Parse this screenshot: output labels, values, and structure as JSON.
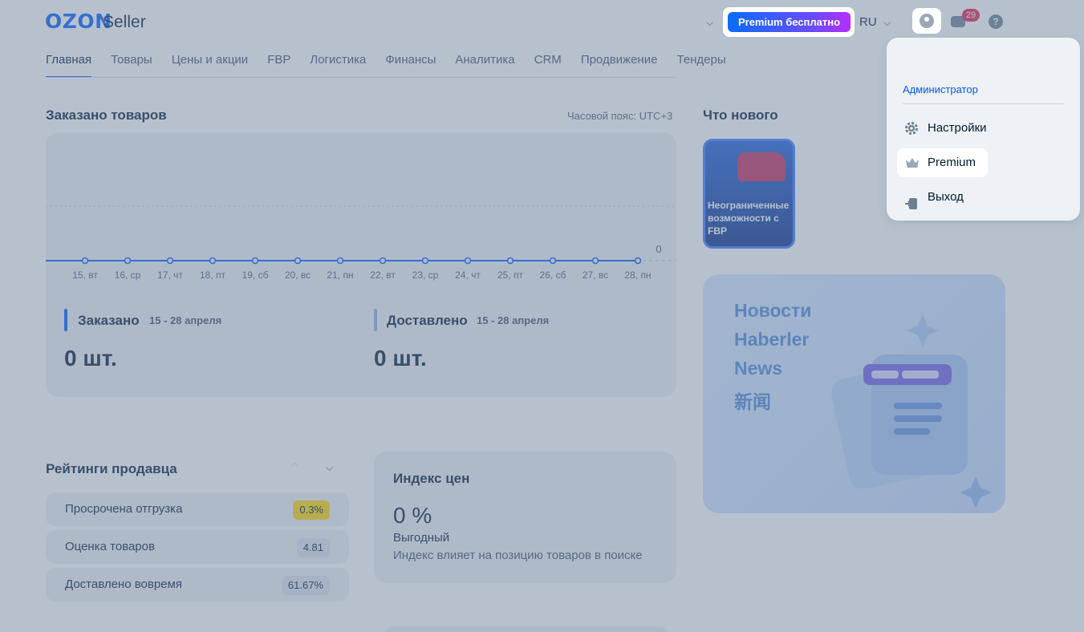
{
  "header": {
    "logo_brand": "OZON",
    "logo_product": "Seller",
    "premium_button": "Premium бесплатно",
    "language": "RU",
    "notifications_count": "29",
    "help_symbol": "?"
  },
  "tabs": [
    {
      "label": "Главная",
      "active": true
    },
    {
      "label": "Товары"
    },
    {
      "label": "Цены и акции"
    },
    {
      "label": "FBP"
    },
    {
      "label": "Логистика"
    },
    {
      "label": "Финансы"
    },
    {
      "label": "Аналитика"
    },
    {
      "label": "CRM"
    },
    {
      "label": "Продвижение"
    },
    {
      "label": "Тендеры"
    }
  ],
  "orders": {
    "title": "Заказано товаров",
    "timezone": "Часовой пояс: UTC+3",
    "ordered_label": "Заказано",
    "ordered_range": "15 - 28 апреля",
    "ordered_value": "0 шт.",
    "delivered_label": "Доставлено",
    "delivered_range": "15 - 28 апреля",
    "delivered_value": "0 шт."
  },
  "chart_data": {
    "type": "line",
    "title": "",
    "categories": [
      "15, вт",
      "16, ср",
      "17, чт",
      "18, пт",
      "19, сб",
      "20, вс",
      "21, пн",
      "22, вт",
      "23, ср",
      "24, чт",
      "25, пт",
      "26, сб",
      "27, вс",
      "28, пн"
    ],
    "series": [
      {
        "values": [
          0,
          0,
          0,
          0,
          0,
          0,
          0,
          0,
          0,
          0,
          0,
          0,
          0,
          0
        ]
      }
    ],
    "y_tick_label": "0",
    "grid": "dotted",
    "colors": {
      "line": "#005bff"
    }
  },
  "whats_new": {
    "title": "Что нового",
    "thumb_text": "Неограниченные возможности с FBP",
    "banner_lines": [
      "Новости",
      "Haberler",
      "News",
      "新闻"
    ]
  },
  "ratings": {
    "title": "Рейтинги продавца",
    "items": [
      {
        "label": "Просрочена отгрузка",
        "value": "0.3%",
        "color": "#ffd600"
      },
      {
        "label": "Оценка товаров",
        "value": "4.81",
        "color": "#dde3ea"
      },
      {
        "label": "Доставлено вовремя",
        "value": "61.67%",
        "color": "#dde3ea"
      }
    ]
  },
  "price_index": {
    "title": "Индекс цен",
    "value": "0 %",
    "status": "Выгодный",
    "description": "Индекс влияет на позицию товаров в поиске"
  },
  "dropdown": {
    "role": "Администратор",
    "items": [
      {
        "label": "Настройки",
        "icon": "gear-icon"
      },
      {
        "label": "Premium",
        "icon": "crown-icon"
      },
      {
        "label": "Выход",
        "icon": "exit-icon"
      }
    ]
  }
}
